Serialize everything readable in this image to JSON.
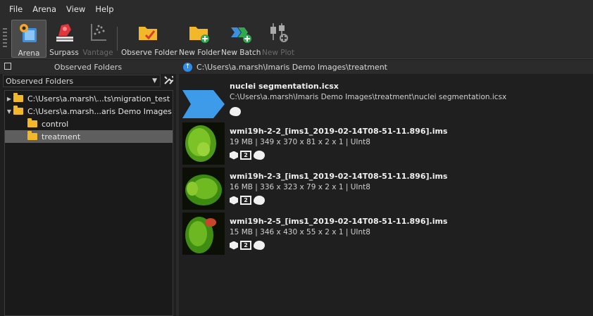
{
  "menu": [
    "File",
    "Arena",
    "View",
    "Help"
  ],
  "toolbar": {
    "arena": "Arena",
    "surpass": "Surpass",
    "vantage": "Vantage",
    "observe_folder": "Observe Folder",
    "new_folder": "New Folder",
    "new_batch": "New Batch",
    "new_plot": "New Plot"
  },
  "left_panel": {
    "title": "Observed Folders",
    "combo_value": "Observed Folders",
    "tree": [
      {
        "label": "C:\\Users\\a.marsh\\...ts\\migration_test",
        "expanded": false
      },
      {
        "label": "C:\\Users\\a.marsh...aris Demo Images",
        "expanded": true
      },
      {
        "label": "control"
      },
      {
        "label": "treatment",
        "selected": true
      }
    ]
  },
  "right_panel": {
    "path": "C:\\Users\\a.marsh\\Imaris Demo Images\\treatment"
  },
  "items": [
    {
      "name": "nuclei segmentation.icsx",
      "meta": "C:\\Users\\a.marsh\\Imaris Demo Images\\treatment\\nuclei segmentation.icsx",
      "icons": [
        "blob-icon"
      ]
    },
    {
      "name": "wmi19h-2-2_[ims1_2019-02-14T08-51-11.896].ims",
      "meta": "19 MB | 349 x 370 x 81 x 2 x 1 | UInt8",
      "badge": "2",
      "icons": [
        "cube-icon",
        "two-icon",
        "blob-icon"
      ]
    },
    {
      "name": "wmi19h-2-3_[ims1_2019-02-14T08-51-11.896].ims",
      "meta": "16 MB | 336 x 323 x 79 x 2 x 1 | UInt8",
      "badge": "2",
      "icons": [
        "cube-icon",
        "two-icon",
        "blob-icon"
      ]
    },
    {
      "name": "wmi19h-2-5_[ims1_2019-02-14T08-51-11.896].ims",
      "meta": "15 MB | 346 x 430 x 55 x 2 x 1 | UInt8",
      "badge": "2",
      "icons": [
        "cube-icon",
        "two-icon",
        "blob-icon"
      ]
    }
  ],
  "colors": {
    "background": "#1f1f1f",
    "panel": "#2b2b2b",
    "selected": "#5e5e5e",
    "folder": "#f2b82a",
    "accent": "#2f8de8"
  }
}
